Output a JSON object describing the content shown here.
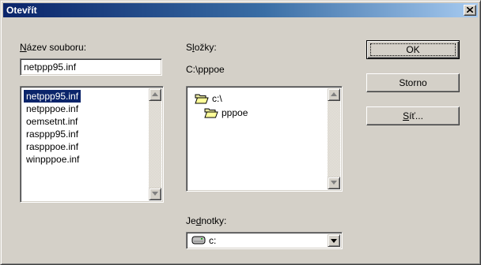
{
  "window": {
    "title": "Otevřít",
    "close_icon": "close-icon"
  },
  "filename": {
    "label_mnemonic": "N",
    "label_rest": "ázev souboru:",
    "value": "netppp95.inf"
  },
  "files": {
    "items": [
      "netppp95.inf",
      "netpppoe.inf",
      "oemsetnt.inf",
      "rasppp95.inf",
      "raspppoe.inf",
      "winpppoe.inf"
    ],
    "selected_index": 0
  },
  "folders": {
    "label_pre": "S",
    "label_mnemonic": "l",
    "label_rest": "ožky:",
    "current_path": "C:\\pppoe",
    "items": [
      {
        "name": "c:\\",
        "icon": "open-folder-icon"
      },
      {
        "name": "pppoe",
        "icon": "open-folder-icon"
      }
    ]
  },
  "drives": {
    "label_pre": "Je",
    "label_mnemonic": "d",
    "label_rest": "notky:",
    "value": "c:",
    "icon": "hard-drive-icon"
  },
  "buttons": {
    "ok": "OK",
    "cancel": "Storno",
    "network_mnemonic": "S",
    "network_rest": "íť..."
  },
  "colors": {
    "title_active": "#0a246a",
    "selection": "#0a246a",
    "face": "#d4d0c8",
    "folder": "#ffff99"
  }
}
